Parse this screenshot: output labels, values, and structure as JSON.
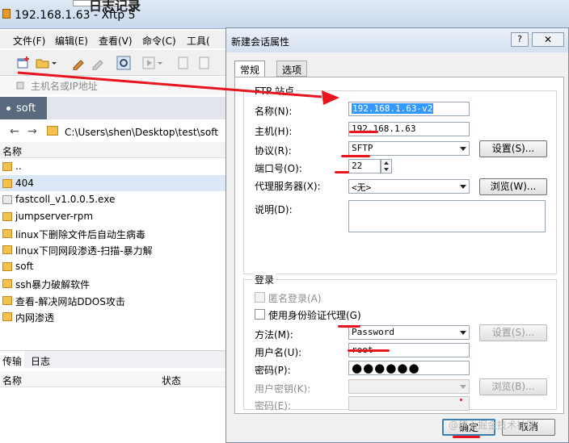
{
  "main_window": {
    "title": "192.168.1.63 - Xftp 5",
    "background_title": "日志记录",
    "menu": [
      "文件(F)",
      "编辑(E)",
      "查看(V)",
      "命令(C)",
      "工具("
    ],
    "address_placeholder": "主机名或IP地址",
    "tab_label": "soft",
    "path": "C:\\Users\\shen\\Desktop\\test\\soft",
    "column_name": "名称",
    "files": [
      "..",
      "404",
      "fastcoll_v1.0.0.5.exe",
      "jumpserver-rpm",
      "linux下删除文件后自动生病毒",
      "linux下同网段渗透-扫描-暴力解",
      "soft",
      "ssh暴力破解软件",
      "查看-解决网站DDOS攻击",
      "内网渗透"
    ],
    "bottom_tabs": [
      "传输",
      "日志"
    ],
    "transfer_columns": [
      "名称",
      "状态"
    ]
  },
  "dialog": {
    "title": "新建会话属性",
    "help_label": "?",
    "close_label": "✕",
    "tabs": [
      "常规",
      "选项"
    ],
    "ftp_group_label": "FTP 站点",
    "name_label": "名称(N):",
    "name_value": "192.168.1.63-v2",
    "host_label": "主机(H):",
    "host_value": "192.168.1.63",
    "protocol_label": "协议(R):",
    "protocol_value": "SFTP",
    "settings_button": "设置(S)...",
    "port_label": "端口号(O):",
    "port_value": "22",
    "proxy_label": "代理服务器(X):",
    "proxy_value": "<无>",
    "browse_button": "浏览(W)...",
    "description_label": "说明(D):",
    "login_group_label": "登录",
    "anonymous_label": "匿名登录(A)",
    "auth_agent_label": "使用身份验证代理(G)",
    "method_label": "方法(M):",
    "method_value": "Password",
    "method_settings_button": "设置(S)...",
    "username_label": "用户名(U):",
    "username_value": "root",
    "password_label": "密码(P):",
    "password_value": "●●●●●●",
    "user_key_label": "用户密钥(K):",
    "key_browse_button": "浏览(B)...",
    "passphrase_label": "密码(E):",
    "ok_button": "确定",
    "cancel_button": "取消"
  },
  "watermark": "@稀土掘金技术社区",
  "colors": {
    "annotation_red": "#e8141e",
    "selection_blue": "#3399ff",
    "tab_dark": "#5a6a7e"
  }
}
